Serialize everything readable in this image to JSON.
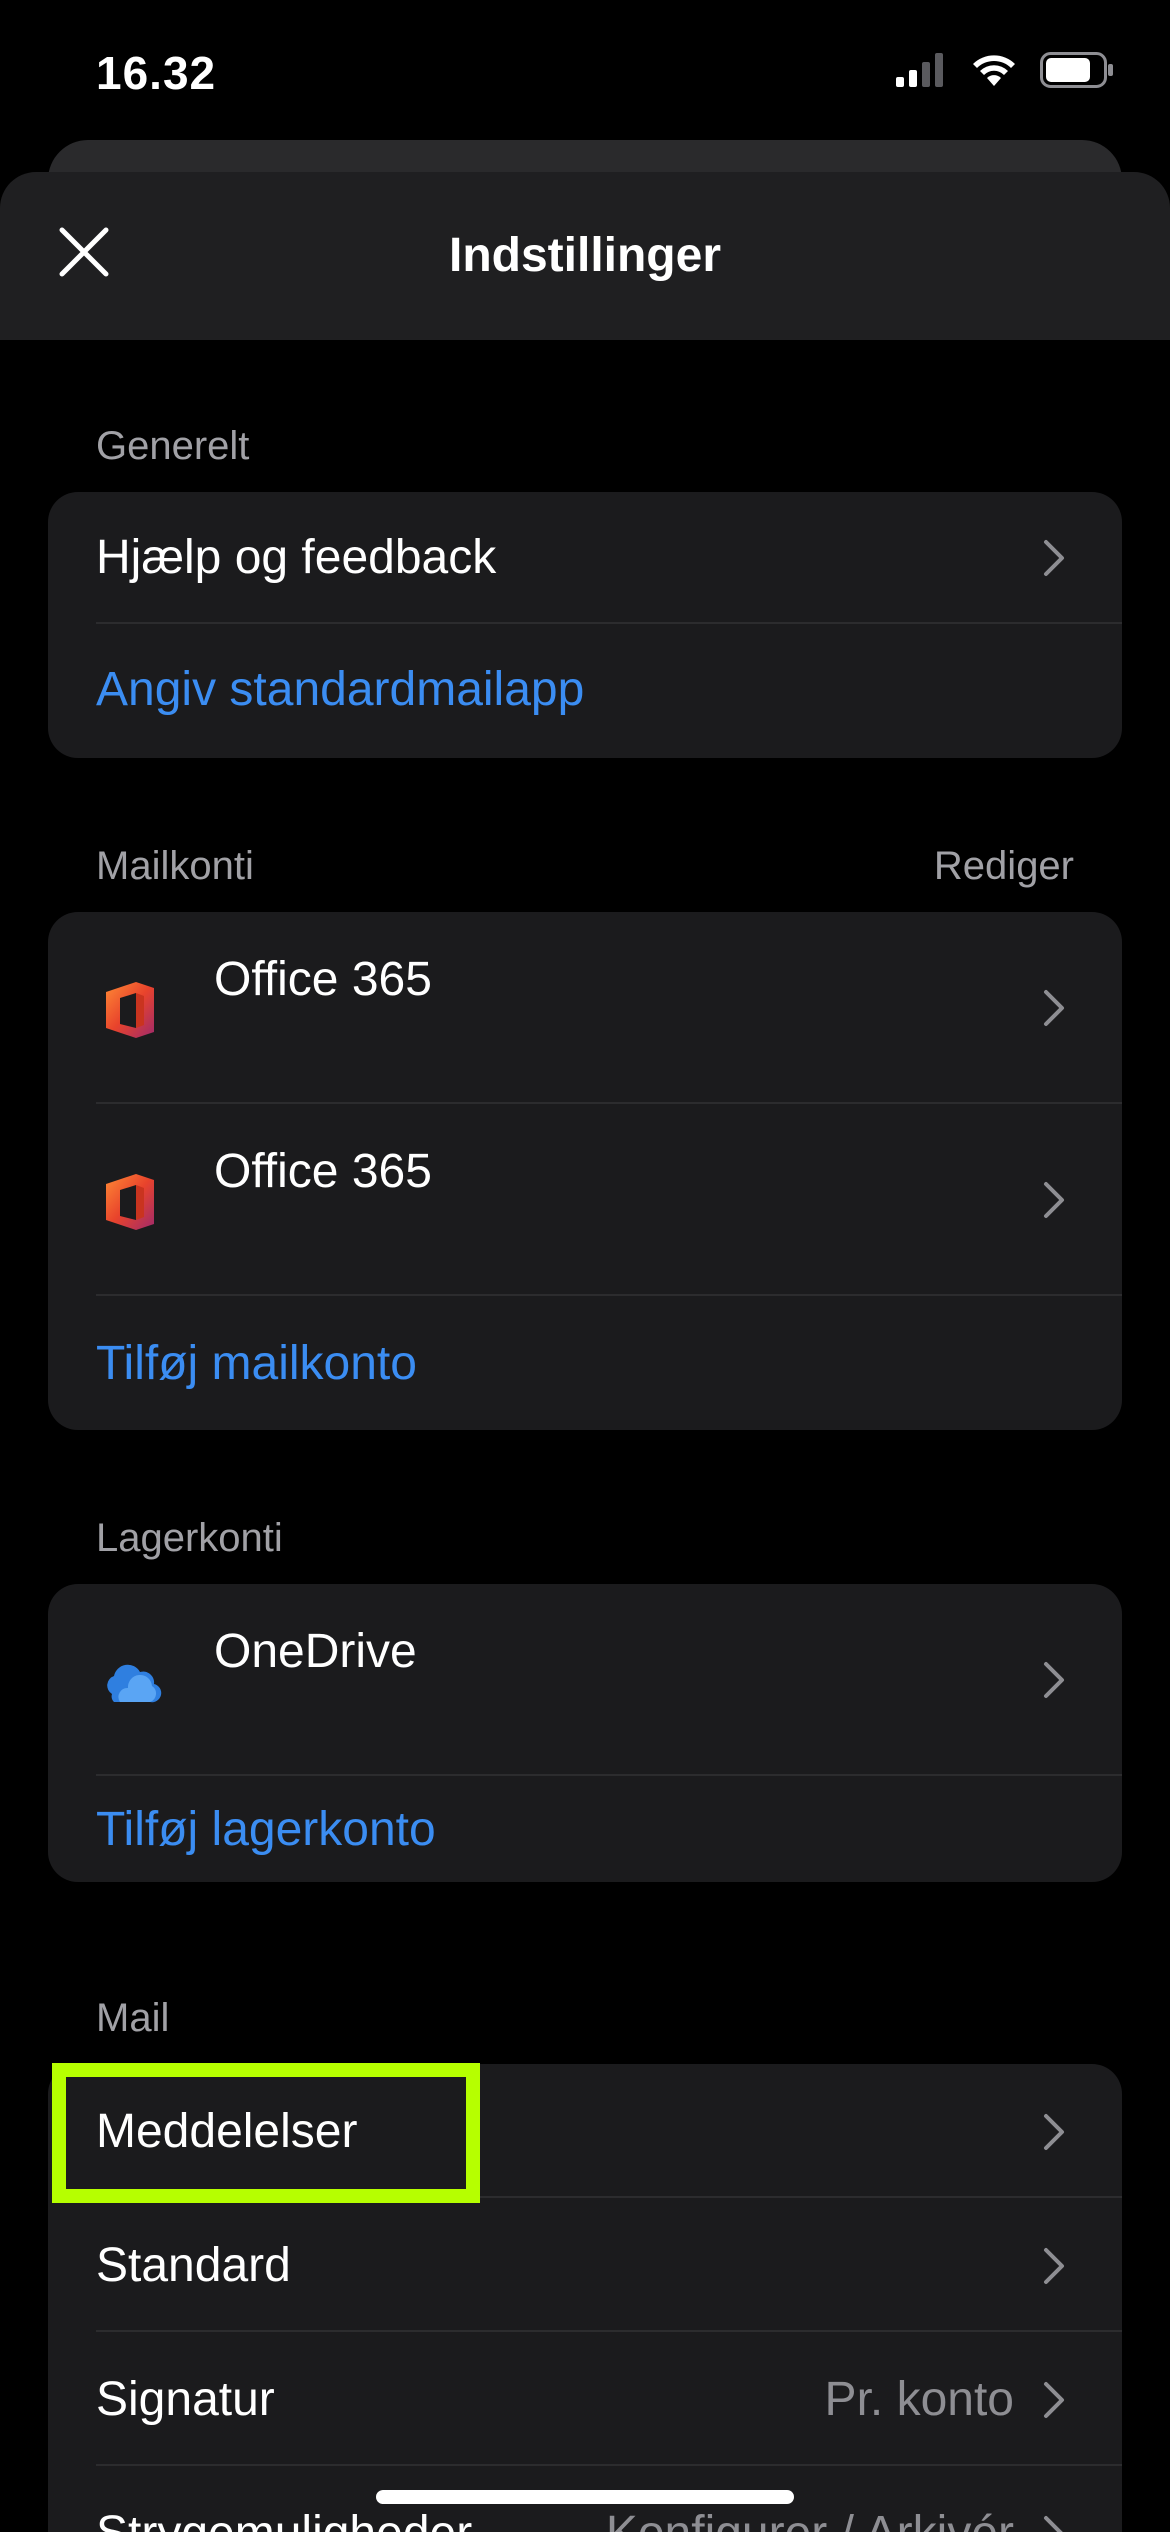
{
  "status_bar": {
    "time": "16.32"
  },
  "header": {
    "title": "Indstillinger"
  },
  "general": {
    "label": "Generelt",
    "items": [
      {
        "label": "Hjælp og feedback"
      },
      {
        "label": "Angiv standardmailapp"
      }
    ]
  },
  "mail_accounts": {
    "label": "Mailkonti",
    "edit_label": "Rediger",
    "accounts": [
      {
        "name": "Office 365",
        "icon": "office-365-icon"
      },
      {
        "name": "Office 365",
        "icon": "office-365-icon"
      }
    ],
    "add_label": "Tilføj mailkonto"
  },
  "storage_accounts": {
    "label": "Lagerkonti",
    "accounts": [
      {
        "name": "OneDrive",
        "icon": "onedrive-icon"
      }
    ],
    "add_label": "Tilføj lagerkonto"
  },
  "mail": {
    "label": "Mail",
    "items": [
      {
        "label": "Meddelelser"
      },
      {
        "label": "Standard"
      },
      {
        "label": "Signatur",
        "value": "Pr. konto"
      },
      {
        "label": "Strygemuligheder",
        "value": "Konfigurer / Arkivér"
      }
    ]
  },
  "colors": {
    "accent_link": "#3b8df2",
    "highlight": "#b6ff00",
    "group_bg": "#1b1b1d",
    "header_bg": "#1f1f21"
  }
}
